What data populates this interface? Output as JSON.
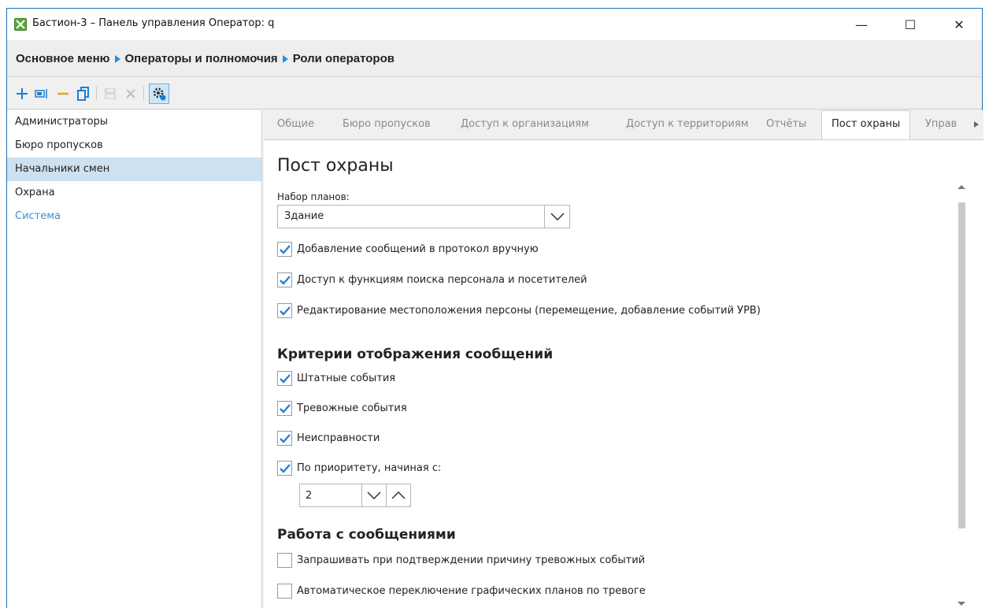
{
  "window": {
    "title": "Бастион-3 – Панель управления Оператор: q",
    "icon": "app-icon",
    "controls": {
      "minimize": "—",
      "maximize": "☐",
      "close": "✕"
    }
  },
  "breadcrumb": [
    "Основное меню",
    "Операторы и полномочия",
    "Роли операторов"
  ],
  "toolbar": {
    "buttons": [
      "add-icon",
      "rename-icon",
      "remove-icon",
      "copy-icon",
      "save-icon",
      "cancel-icon",
      "settings-icon"
    ],
    "accent": "#1a7fd4"
  },
  "roles": [
    {
      "label": "Администраторы"
    },
    {
      "label": "Бюро пропусков"
    },
    {
      "label": "Начальники смен",
      "selected": true
    },
    {
      "label": "Охрана"
    },
    {
      "label": "Система",
      "system": true
    }
  ],
  "tabs": [
    {
      "label": "Общие"
    },
    {
      "label": "Бюро пропусков"
    },
    {
      "label": "Доступ к организациям"
    },
    {
      "label": "Доступ к территориям"
    },
    {
      "label": "Отчёты"
    },
    {
      "label": "Пост охраны",
      "active": true
    },
    {
      "label": "Управ"
    }
  ],
  "post": {
    "heading": "Пост охраны",
    "plan_set_label": "Набор планов:",
    "plan_set_value": "Здание",
    "checks": [
      {
        "label": "Добавление сообщений в протокол вручную",
        "checked": true
      },
      {
        "label": "Доступ к функциям поиска персонала и посетителей",
        "checked": true
      },
      {
        "label": "Редактирование местоположения персоны (перемещение, добавление событий УРВ)",
        "checked": true
      }
    ],
    "criteria_title": "Критерии отображения сообщений",
    "criteria": [
      {
        "label": "Штатные события",
        "checked": true
      },
      {
        "label": "Тревожные события",
        "checked": true
      },
      {
        "label": "Неисправности",
        "checked": true
      },
      {
        "label": "По приоритету, начиная с:",
        "checked": true
      }
    ],
    "priority_value": "2",
    "messages_title": "Работа с сообщениями",
    "messages": [
      {
        "label": "Запрашивать при подтверждении причину тревожных событий",
        "checked": false
      },
      {
        "label": "Автоматическое переключение графических планов по тревоге",
        "checked": false
      }
    ]
  },
  "colors": {
    "window_border": "#1f6fb5",
    "selection": "#cde1f1",
    "system_role": "#3f8dd0",
    "check": "#2a7fd4"
  }
}
